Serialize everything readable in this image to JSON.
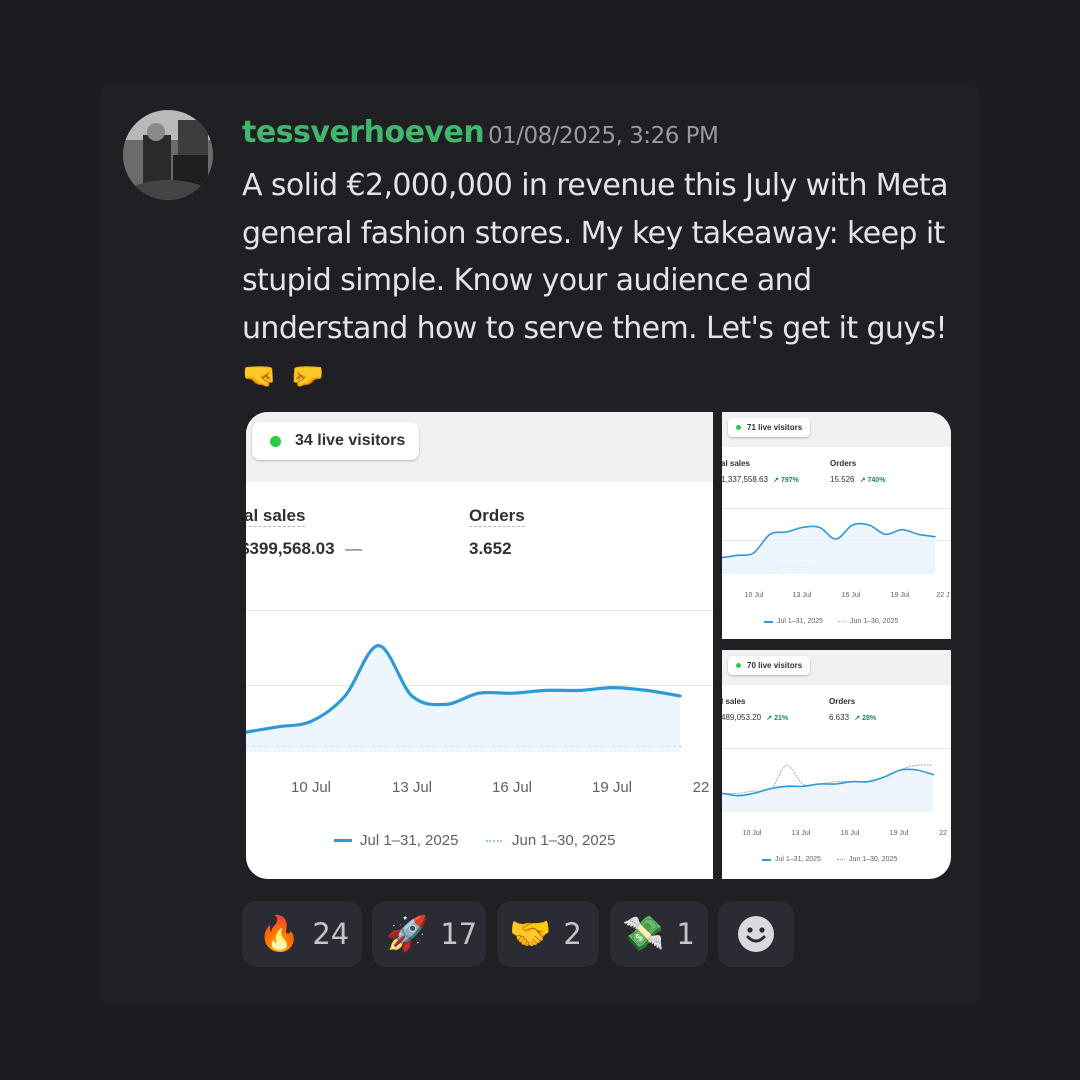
{
  "message": {
    "username": "tessverhoeven",
    "timestamp": "01/08/2025, 3:26 PM",
    "text": "A solid €2,000,000 in revenue this July with Meta general fashion stores. My key takeaway: keep it stupid simple. Know your audience and understand how to serve them. Let's get it guys!",
    "trailing_emoji": "🤜 🤛",
    "avatar": "avatar-photo"
  },
  "attachments": [
    {
      "live_visitors": "34 live visitors",
      "sales_label": "al sales",
      "sales_value": "$399,568.03",
      "sales_change": "—",
      "orders_label": "Orders",
      "orders_value": "3.652",
      "orders_change": "",
      "x_ticks": [
        "10 Jul",
        "13 Jul",
        "16 Jul",
        "19 Jul",
        "22"
      ],
      "legend_current": "Jul 1–31, 2025",
      "legend_previous": "Jun 1–30, 2025"
    },
    {
      "live_visitors": "71 live visitors",
      "sales_label": "al sales",
      "sales_value": ",1,337,558.63",
      "sales_change": "↗ 797%",
      "orders_label": "Orders",
      "orders_value": "15.526",
      "orders_change": "↗ 740%",
      "x_ticks": [
        "10 Jul",
        "13 Jul",
        "16 Jul",
        "19 Jul",
        "22 J"
      ],
      "legend_current": "Jul 1–31, 2025",
      "legend_previous": "Jun 1–30, 2025"
    },
    {
      "live_visitors": "70 live visitors",
      "sales_label": "l sales",
      "sales_value": "489,053.20",
      "sales_change": "↗ 21%",
      "orders_label": "Orders",
      "orders_value": "6.633",
      "orders_change": "↗ 28%",
      "x_ticks": [
        "10 Jul",
        "13 Jul",
        "16 Jul",
        "19 Jul",
        "22"
      ],
      "legend_current": "Jul 1–31, 2025",
      "legend_previous": "Jun 1–30, 2025"
    }
  ],
  "chart_data": [
    {
      "type": "line",
      "x": [
        "8 Jul",
        "9 Jul",
        "10 Jul",
        "11 Jul",
        "12 Jul",
        "13 Jul",
        "14 Jul",
        "15 Jul",
        "16 Jul",
        "17 Jul",
        "18 Jul",
        "19 Jul",
        "20 Jul",
        "21 Jul",
        "22 Jul"
      ],
      "series": [
        {
          "name": "Jul 1–31, 2025",
          "values": [
            5,
            7,
            9,
            11,
            20,
            38,
            20,
            17,
            21,
            21,
            22,
            22,
            23,
            22,
            20
          ],
          "style": "solid",
          "color": "#2d9ad8"
        },
        {
          "name": "Jun 1–30, 2025",
          "values": [
            2,
            2,
            2,
            2,
            2,
            2,
            2,
            2,
            2,
            2,
            2,
            2,
            2,
            2,
            2
          ],
          "style": "dotted",
          "color": "#8fcbe4"
        }
      ],
      "ylim": [
        0,
        50
      ],
      "grid": true,
      "legend": "bottom"
    },
    {
      "type": "line",
      "x": [
        "8 Jul",
        "9 Jul",
        "10 Jul",
        "11 Jul",
        "12 Jul",
        "13 Jul",
        "14 Jul",
        "15 Jul",
        "16 Jul",
        "17 Jul",
        "18 Jul",
        "19 Jul",
        "20 Jul",
        "21 Jul",
        "22 Jul"
      ],
      "series": [
        {
          "name": "Jul 1–31, 2025",
          "values": [
            7,
            7,
            8,
            9,
            17,
            18,
            20,
            20,
            15,
            21,
            21,
            17,
            19,
            17,
            16
          ],
          "style": "solid",
          "color": "#2d9ad8"
        },
        {
          "name": "Jun 1–30, 2025",
          "values": [
            2,
            2,
            2,
            2,
            2,
            3,
            3,
            2,
            2,
            2,
            2,
            2,
            2,
            2,
            2
          ],
          "style": "dotted",
          "color": "#8fcbe4"
        }
      ],
      "ylim": [
        0,
        30
      ],
      "grid": true,
      "legend": "bottom"
    },
    {
      "type": "line",
      "x": [
        "8 Jul",
        "9 Jul",
        "10 Jul",
        "11 Jul",
        "12 Jul",
        "13 Jul",
        "14 Jul",
        "15 Jul",
        "16 Jul",
        "17 Jul",
        "18 Jul",
        "19 Jul",
        "20 Jul",
        "21 Jul",
        "22 Jul"
      ],
      "series": [
        {
          "name": "Jul 1–31, 2025",
          "values": [
            8,
            8,
            7,
            8,
            10,
            11,
            11,
            12,
            12,
            13,
            13,
            15,
            18,
            18,
            16
          ],
          "style": "solid",
          "color": "#2d9ad8"
        },
        {
          "name": "Jun 1–30, 2025",
          "values": [
            8,
            8,
            8,
            9,
            9,
            20,
            12,
            12,
            13,
            13,
            13,
            13,
            18,
            20,
            20
          ],
          "style": "dotted",
          "color": "#9ca3aa"
        }
      ],
      "ylim": [
        0,
        30
      ],
      "grid": true,
      "legend": "bottom"
    }
  ],
  "reactions": [
    {
      "emoji": "🔥",
      "count": "24"
    },
    {
      "emoji": "🚀",
      "count": "17"
    },
    {
      "emoji": "🤝",
      "count": "2"
    },
    {
      "emoji": "💸",
      "count": "1"
    }
  ],
  "add_reaction_icon": "smiley-icon"
}
